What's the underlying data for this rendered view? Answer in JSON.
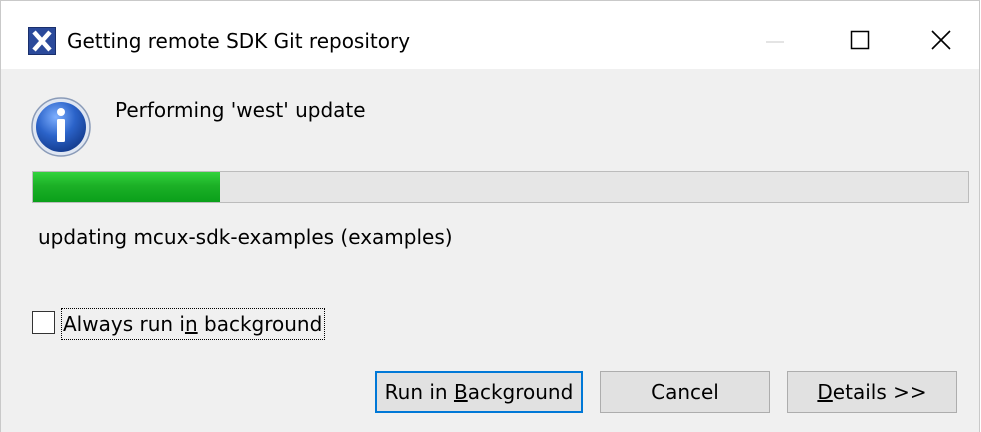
{
  "window": {
    "title": "Getting remote SDK Git repository",
    "controls": {
      "minimize_icon": "minimize-icon",
      "maximize_icon": "maximize-icon",
      "close_icon": "close-icon"
    }
  },
  "dialog": {
    "icon": "info-icon",
    "message": "Performing 'west' update",
    "progress": {
      "fraction": 0.2,
      "color": "#1cb027"
    },
    "subtask": "updating mcux-sdk-examples (examples)",
    "checkbox": {
      "label": "Always run in background",
      "checked": false
    }
  },
  "buttons": {
    "run_in_background": "Run in Background",
    "cancel": "Cancel",
    "details": "Details >>"
  },
  "colors": {
    "focus_border": "#0078d7",
    "app_icon": "#2b4a9b",
    "info_icon": "#1f4fa8"
  }
}
